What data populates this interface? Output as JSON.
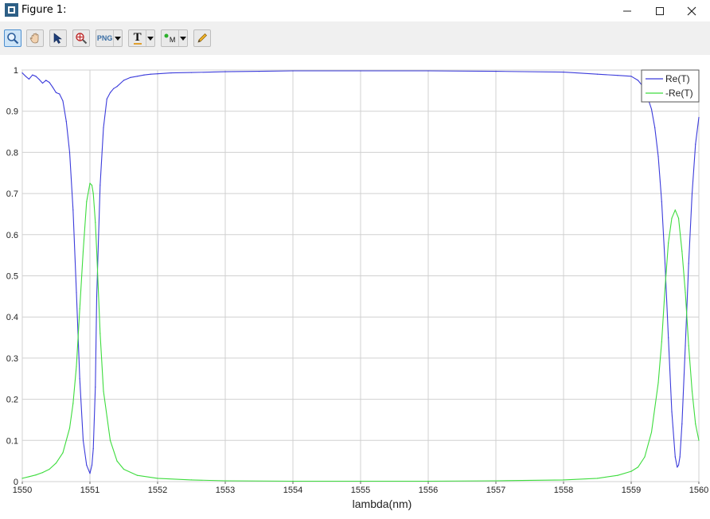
{
  "window": {
    "title": "Figure 1:",
    "icon": "figure-window-icon",
    "controls": [
      "minimize-icon",
      "maximize-icon",
      "close-icon"
    ]
  },
  "toolbar": {
    "tools": [
      {
        "name": "zoom-tool",
        "icon": "magnifier-icon",
        "active": true
      },
      {
        "name": "pan-tool",
        "icon": "hand-icon",
        "active": false
      },
      {
        "name": "select-tool",
        "icon": "arrow-cursor-icon",
        "active": false
      },
      {
        "name": "zoom-reset-tool",
        "icon": "target-magnifier-icon",
        "active": false
      },
      {
        "name": "export-png-tool",
        "icon": "png-icon",
        "label": "PNG",
        "dropdown": true
      },
      {
        "name": "text-tool",
        "icon": "text-t-icon",
        "label": "T",
        "dropdown": true
      },
      {
        "name": "marker-tool",
        "icon": "marker-icon",
        "label": "M",
        "dropdown": true
      },
      {
        "name": "edit-tool",
        "icon": "pencil-icon",
        "active": false
      }
    ]
  },
  "chart_data": {
    "type": "line",
    "xlabel": "lambda(nm)",
    "ylabel": "",
    "title": "",
    "xlim": [
      1550,
      1560
    ],
    "ylim": [
      0,
      1
    ],
    "xticks": [
      "1550",
      "1551",
      "1552",
      "1553",
      "1554",
      "1555",
      "1556",
      "1557",
      "1558",
      "1559",
      "1560"
    ],
    "yticks": [
      "0",
      "0.1",
      "0.2",
      "0.3",
      "0.4",
      "0.5",
      "0.6",
      "0.7",
      "0.8",
      "0.9",
      "1"
    ],
    "grid": true,
    "legend_position": "top-right",
    "series": [
      {
        "name": "Re(T)",
        "color": "#3b3bdb",
        "x": [
          1550,
          1550.05,
          1550.1,
          1550.15,
          1550.2,
          1550.25,
          1550.3,
          1550.35,
          1550.4,
          1550.45,
          1550.5,
          1550.55,
          1550.6,
          1550.65,
          1550.7,
          1550.75,
          1550.8,
          1550.85,
          1550.9,
          1550.95,
          1551.0,
          1551.03,
          1551.05,
          1551.08,
          1551.1,
          1551.15,
          1551.2,
          1551.25,
          1551.3,
          1551.35,
          1551.4,
          1551.5,
          1551.6,
          1551.7,
          1551.8,
          1551.9,
          1552.0,
          1552.2,
          1552.5,
          1553.0,
          1553.5,
          1554.0,
          1555.0,
          1556.0,
          1557.0,
          1558.0,
          1558.5,
          1558.8,
          1559.0,
          1559.1,
          1559.2,
          1559.3,
          1559.35,
          1559.4,
          1559.45,
          1559.5,
          1559.55,
          1559.6,
          1559.65,
          1559.68,
          1559.7,
          1559.72,
          1559.75,
          1559.8,
          1559.85,
          1559.9,
          1559.95,
          1560.0
        ],
        "y": [
          0.993,
          0.985,
          0.978,
          0.988,
          0.985,
          0.977,
          0.968,
          0.975,
          0.97,
          0.958,
          0.945,
          0.942,
          0.925,
          0.875,
          0.8,
          0.66,
          0.46,
          0.25,
          0.1,
          0.04,
          0.02,
          0.04,
          0.08,
          0.23,
          0.45,
          0.72,
          0.86,
          0.93,
          0.945,
          0.955,
          0.96,
          0.975,
          0.982,
          0.985,
          0.988,
          0.99,
          0.991,
          0.993,
          0.994,
          0.996,
          0.997,
          0.998,
          0.998,
          0.998,
          0.997,
          0.995,
          0.99,
          0.987,
          0.985,
          0.975,
          0.955,
          0.905,
          0.86,
          0.79,
          0.68,
          0.53,
          0.35,
          0.17,
          0.06,
          0.035,
          0.04,
          0.06,
          0.14,
          0.33,
          0.53,
          0.7,
          0.82,
          0.885
        ]
      },
      {
        "name": "-Re(T)",
        "color": "#3ddc3d",
        "x": [
          1550,
          1550.1,
          1550.2,
          1550.3,
          1550.4,
          1550.5,
          1550.6,
          1550.7,
          1550.75,
          1550.8,
          1550.85,
          1550.9,
          1550.95,
          1551.0,
          1551.03,
          1551.05,
          1551.08,
          1551.1,
          1551.15,
          1551.2,
          1551.3,
          1551.4,
          1551.5,
          1551.7,
          1552.0,
          1552.5,
          1553.0,
          1554.0,
          1555.0,
          1556.0,
          1557.0,
          1558.0,
          1558.5,
          1558.8,
          1559.0,
          1559.1,
          1559.2,
          1559.3,
          1559.4,
          1559.45,
          1559.5,
          1559.55,
          1559.6,
          1559.65,
          1559.7,
          1559.75,
          1559.8,
          1559.85,
          1559.9,
          1559.95,
          1560.0
        ],
        "y": [
          0.008,
          0.012,
          0.016,
          0.022,
          0.03,
          0.045,
          0.07,
          0.13,
          0.19,
          0.28,
          0.42,
          0.56,
          0.68,
          0.725,
          0.72,
          0.7,
          0.63,
          0.56,
          0.36,
          0.22,
          0.1,
          0.05,
          0.03,
          0.015,
          0.008,
          0.004,
          0.002,
          0.001,
          0.001,
          0.001,
          0.002,
          0.004,
          0.008,
          0.015,
          0.025,
          0.035,
          0.06,
          0.12,
          0.24,
          0.34,
          0.47,
          0.58,
          0.64,
          0.66,
          0.64,
          0.56,
          0.46,
          0.33,
          0.22,
          0.14,
          0.1
        ]
      }
    ]
  }
}
